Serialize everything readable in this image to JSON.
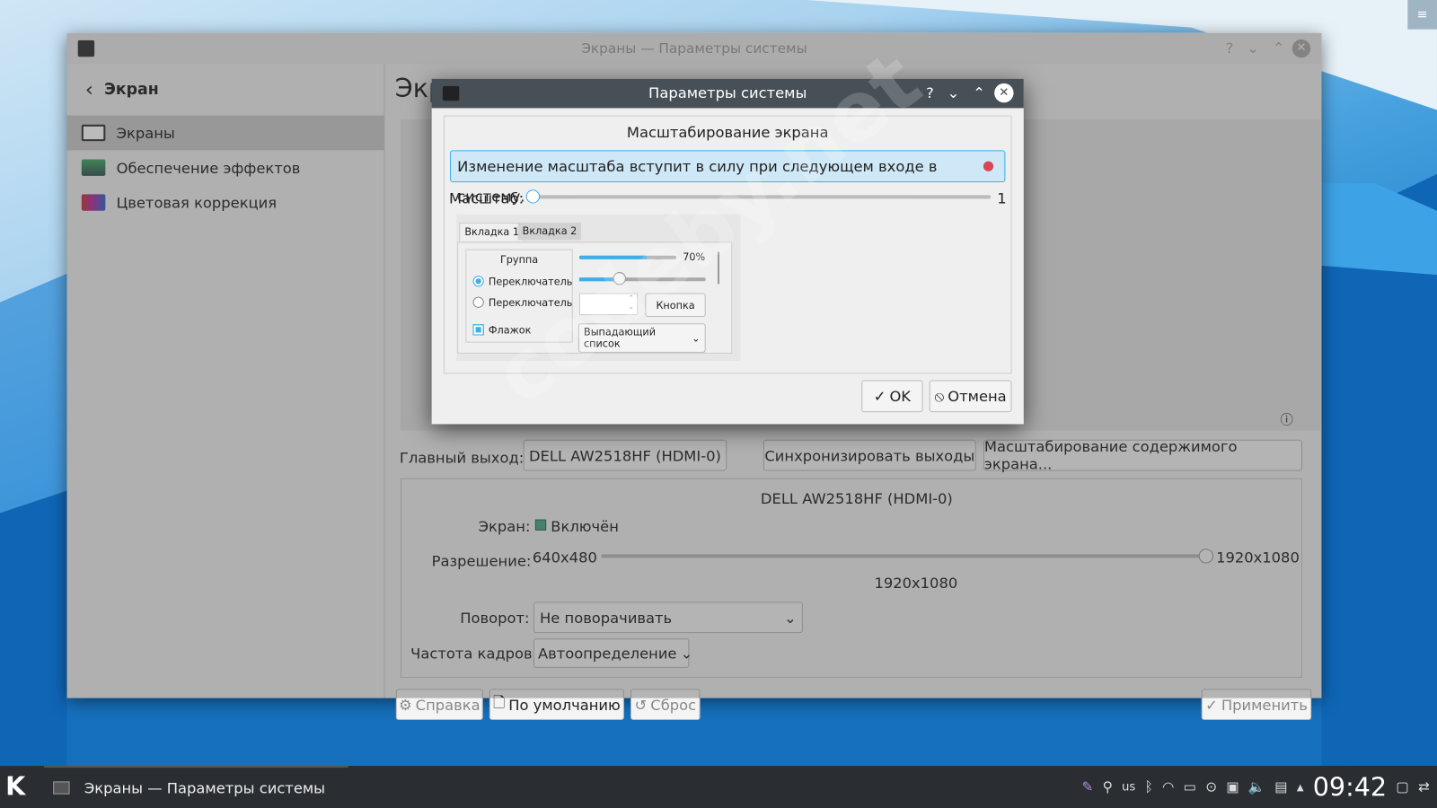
{
  "main_window": {
    "title": "Экраны — Параметры системы",
    "heading_partial": "Экр",
    "sidebar": {
      "back_label": "Экран",
      "items": [
        {
          "label": "Экраны"
        },
        {
          "label": "Обеспечение эффектов"
        },
        {
          "label": "Цветовая коррекция"
        }
      ]
    },
    "primary_output_label": "Главный выход:",
    "primary_output_value": "DELL AW2518HF (HDMI-0)",
    "sync_button": "Синхронизировать выходы",
    "scale_button": "Масштабирование содержимого экрана...",
    "output_name": "DELL AW2518HF (HDMI-0)",
    "screen_label": "Экран:",
    "enabled_label": "Включён",
    "resolution_label": "Разрешение:",
    "res_min": "640x480",
    "res_max": "1920x1080",
    "res_current": "1920x1080",
    "res_fraction": 1.0,
    "rotation_label": "Поворот:",
    "rotation_value": "Не поворачивать",
    "refresh_label": "Частота кадров:",
    "refresh_value": "Автоопределение",
    "help_button": "Справка",
    "defaults_button": "По умолчанию",
    "reset_button": "Сброс",
    "apply_button": "Применить"
  },
  "dialog": {
    "title": "Параметры системы",
    "heading": "Масштабирование экрана",
    "message": "Изменение масштаба вступит в силу при следующем входе в систему.",
    "scale_label": "Масштаб:",
    "scale_value": "1",
    "scale_fraction": 0,
    "preview": {
      "tab1": "Вкладка 1",
      "tab2": "Вкладка 2",
      "group": "Группа",
      "radio1": "Переключатель",
      "radio2": "Переключатель",
      "checkbox": "Флажок",
      "progress": 70,
      "progress_label": "70%",
      "slider_fraction": 0.32,
      "button": "Кнопка",
      "combo": "Выпадающий список"
    },
    "ok": "OK",
    "cancel": "Отмена"
  },
  "taskbar": {
    "task_label": "Экраны  — Параметры системы",
    "keyboard_layout": "us",
    "clock": "09:42"
  },
  "watermark": "codeby.net",
  "colors": {
    "accent": "#3daee9",
    "titlebar": "#475057",
    "taskbar": "#2a2e32"
  }
}
